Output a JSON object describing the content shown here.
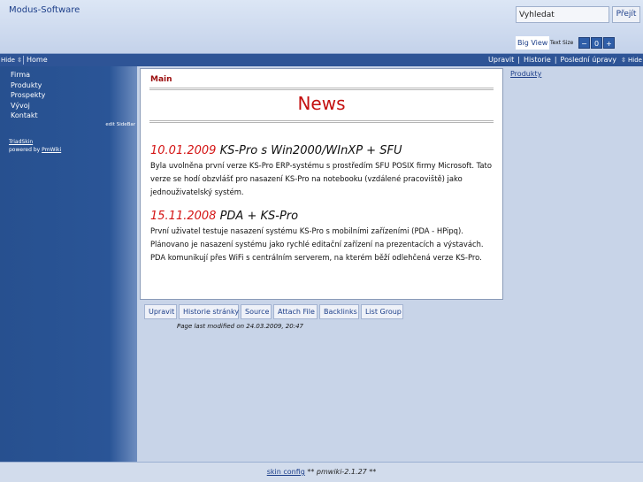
{
  "header": {
    "site_title": "Modus-Software",
    "search_value": "Vyhledat",
    "search_button": "Přejít",
    "bigview_label": "Big View",
    "textsize_label": "Text Size",
    "textsize_minus": "−",
    "textsize_reset": "0",
    "textsize_plus": "+"
  },
  "topbar": {
    "hide_left": "Hide ⇳",
    "home": "Home",
    "actions": [
      "Upravit",
      "Historie",
      "Poslední úpravy"
    ],
    "hide_right": "⇳ Hide"
  },
  "sidebar": {
    "items": [
      "Firma",
      "Produkty",
      "Prospekty",
      "Vývoj",
      "Kontakt"
    ],
    "edit_sidebar": "edit SideBar",
    "skin_link": "TriadSkin",
    "powered_by": "powered by",
    "pmwiki_link": "PmWiki"
  },
  "main": {
    "breadcrumb": "Main",
    "title": "News",
    "news": [
      {
        "date": "10.01.2009",
        "headline": " KS-Pro s Win2000/WInXP + SFU",
        "body": "Byla uvolněna první verze KS-Pro ERP-systému s prostředím SFU POSIX firmy Microsoft. Tato verze se hodí obzvlášť pro nasazení KS-Pro na notebooku (vzdálené pracoviště) jako jednouživatelský systém."
      },
      {
        "date": "15.11.2008",
        "headline": " PDA + KS-Pro",
        "body": "První uživatel testuje nasazení systému KS-Pro s mobilními zařízeními (PDA - HPipq). Plánovano je nasazení systému jako rychlé editační zařízení na prezentacích a výstavách. PDA komunikují přes WiFi s centrálním serverem, na kterém běží odlehčená verze KS-Pro."
      }
    ]
  },
  "actions": {
    "buttons": [
      "Upravit",
      "Historie stránky",
      "Source",
      "Attach File",
      "Backlinks",
      "List Group"
    ],
    "last_modified": "Page last modified on 24.03.2009, 20:47"
  },
  "right_sidebar": {
    "link": "Produkty"
  },
  "footer": {
    "skin_config": "skin config",
    "version": "** pmwiki-2.1.27 **"
  },
  "colors": {
    "sidebar_blue": "#2a5597",
    "topbar_blue": "#2e5496",
    "title_red": "#c41010",
    "breadcrumb_red": "#9b0d0d",
    "background": "#c8d4e8"
  }
}
